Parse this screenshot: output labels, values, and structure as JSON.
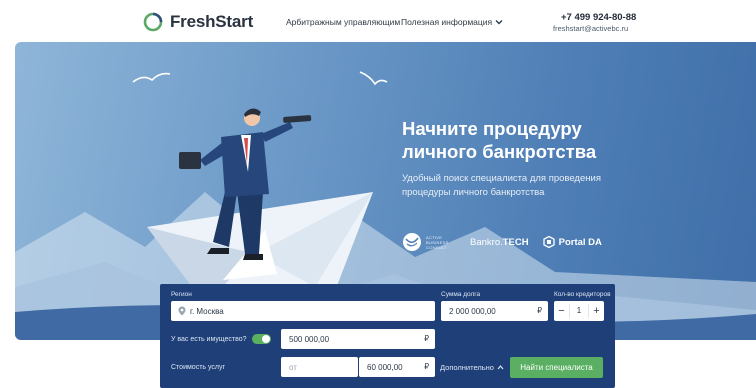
{
  "header": {
    "logo_text": "FreshStart",
    "nav": [
      {
        "label": "Арбитражным управляющим"
      },
      {
        "label": "Полезная информация"
      }
    ],
    "phone": "+7 499 924-80-88",
    "email": "freshstart@activebc.ru"
  },
  "hero": {
    "title": "Начните процедуру личного банкротства",
    "subtitle": "Удобный поиск специалиста для проведения процедуры личного банкротства",
    "partners": {
      "p1": "ACTIVE BUSINESS CONSULT",
      "p2_prefix": "Bankro.",
      "p2_bold": "TECH",
      "p3": "Portal DA"
    }
  },
  "form": {
    "region_label": "Регион",
    "region_value": "г. Москва",
    "debt_label": "Сумма долга",
    "debt_value": "2 000 000,00",
    "creditors_label": "Кол-во кредиторов",
    "creditors_value": "1",
    "property_label": "У вас есть имущество?",
    "property_value": "500 000,00",
    "cost_label": "Стоимость услуг",
    "cost_from_placeholder": "от",
    "cost_to_value": "60 000,00",
    "currency": "₽",
    "more_label": "Дополнительно",
    "submit_label": "Найти специалиста",
    "property_enabled": true
  },
  "colors": {
    "form_bg": "#1e3f78",
    "accent_green": "#5aaf62",
    "hero_blue": "#4f7fb6"
  }
}
